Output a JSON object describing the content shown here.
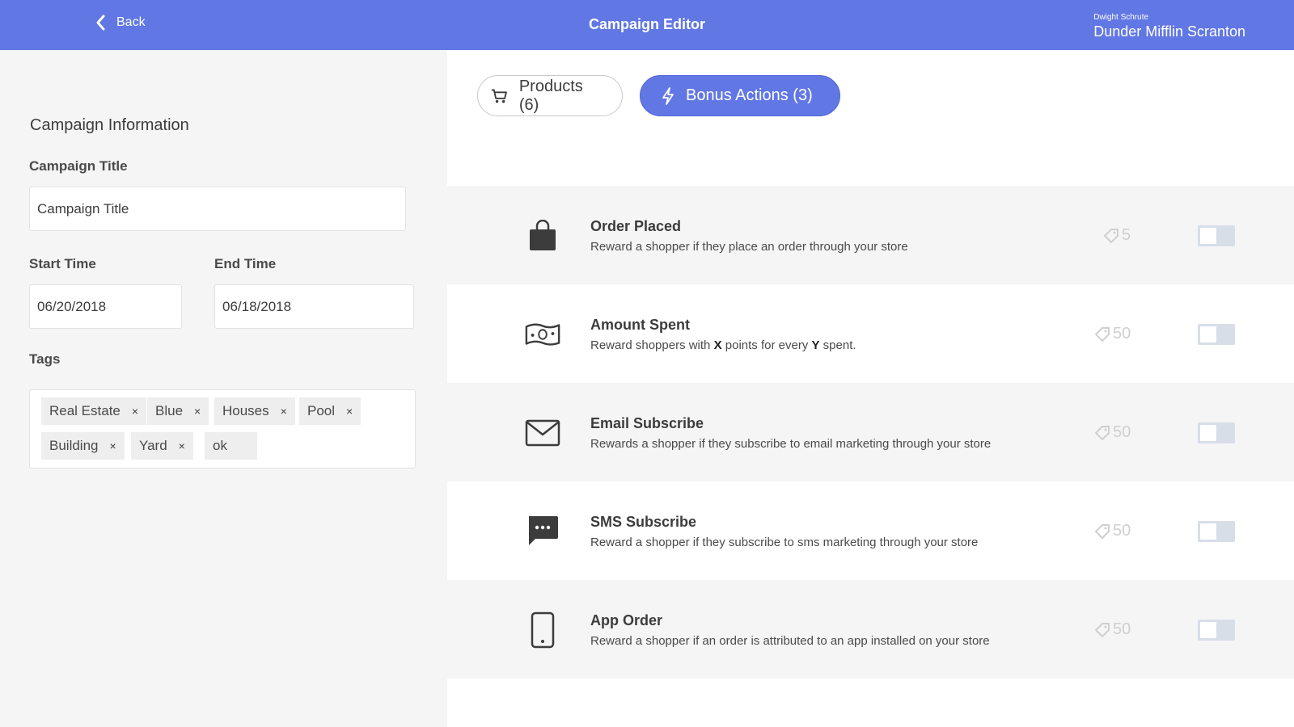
{
  "header": {
    "back_label": "Back",
    "title": "Campaign Editor",
    "user_name": "Dwight Schrute",
    "store_name": "Dunder Mifflin Scranton"
  },
  "form": {
    "section_title": "Campaign Information",
    "title_label": "Campaign Title",
    "title_value": "Campaign Title",
    "start_label": "Start Time",
    "start_value": "06/20/2018",
    "end_label": "End Time",
    "end_value": "06/18/2018",
    "tags_label": "Tags",
    "tags": [
      "Real Estate",
      "Blue",
      "Houses",
      "Pool",
      "Building",
      "Yard"
    ],
    "tag_remove_glyph": "×",
    "tag_input_value": "ok"
  },
  "tabs": {
    "products_label": "Products (6)",
    "bonus_label": "Bonus Actions (3)"
  },
  "actions": [
    {
      "icon": "shopping-bag-icon",
      "title": "Order Placed",
      "desc": "Reward a shopper if they place an order through your store",
      "points": "5",
      "enabled": false
    },
    {
      "icon": "money-bill-icon",
      "title": "Amount Spent",
      "desc_pre": "Reward shoppers with ",
      "desc_x": "X",
      "desc_mid": " points for every ",
      "desc_y": "Y",
      "desc_post": " spent.",
      "points": "50",
      "enabled": false
    },
    {
      "icon": "envelope-icon",
      "title": "Email Subscribe",
      "desc": "Rewards a shopper if they subscribe to email marketing through your store",
      "points": "50",
      "enabled": false
    },
    {
      "icon": "chat-bubble-icon",
      "title": "SMS Subscribe",
      "desc": "Reward a shopper if they subscribe to sms marketing through your store",
      "points": "50",
      "enabled": false
    },
    {
      "icon": "mobile-phone-icon",
      "title": "App Order",
      "desc": "Reward a shopper if an order is attributed to an app installed on your store",
      "points": "50",
      "enabled": false
    }
  ],
  "colors": {
    "accent": "#6177e4",
    "toggle_off": "#d8dee8",
    "points": "#cfcfcf"
  }
}
